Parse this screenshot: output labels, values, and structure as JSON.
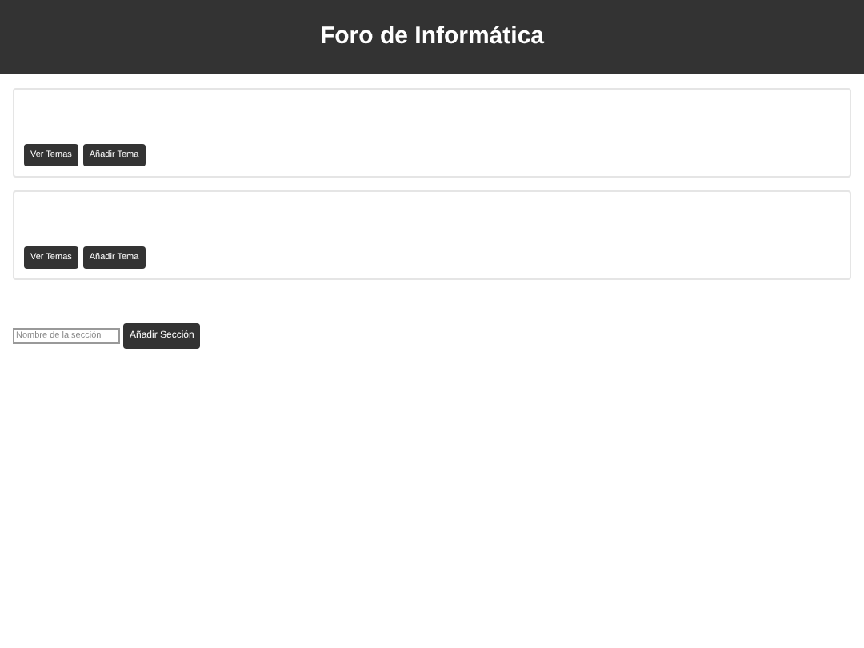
{
  "header": {
    "title": "Foro de Informática"
  },
  "sections": [
    {
      "buttons": [
        "Ver Temas",
        "Añadir Tema"
      ]
    },
    {
      "buttons": [
        "Ver Temas",
        "Añadir Tema"
      ]
    }
  ],
  "new_section": {
    "placeholder": "Nombre de la sección",
    "button": "Añadir Sección"
  }
}
